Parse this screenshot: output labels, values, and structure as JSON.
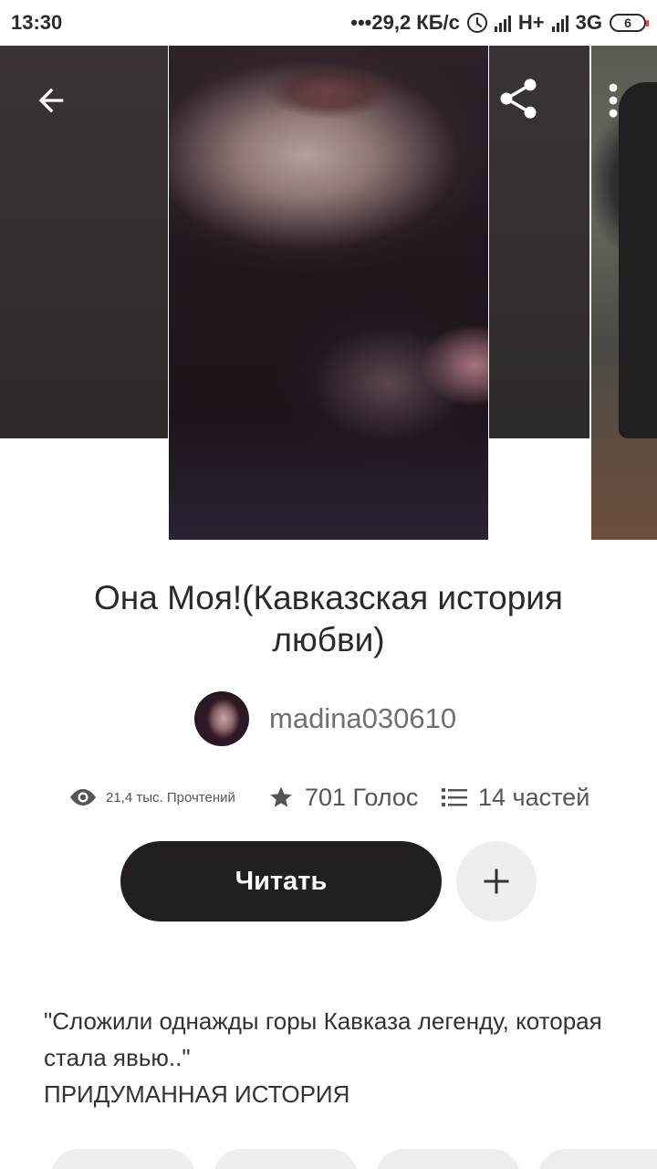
{
  "status_bar": {
    "time": "13:30",
    "speed": "•••29,2 КБ/с",
    "network1": "H+",
    "network2": "3G",
    "battery": "6"
  },
  "header": {
    "back_icon": "arrow-back-icon",
    "share_icon": "share-icon",
    "menu_icon": "more-vert-icon"
  },
  "story": {
    "title": "Она Моя!(Кавказская история любви)",
    "author": "madina030610",
    "reads": "21,4 тыс. Прочтений",
    "votes": "701 Голос",
    "parts": "14 частей",
    "read_label": "Читать",
    "description_line1": "\"Сложили однажды горы Кавказа легенду, которая стала явью..\"",
    "description_line2": "ПРИДУМАННАЯ ИСТОРИЯ"
  }
}
